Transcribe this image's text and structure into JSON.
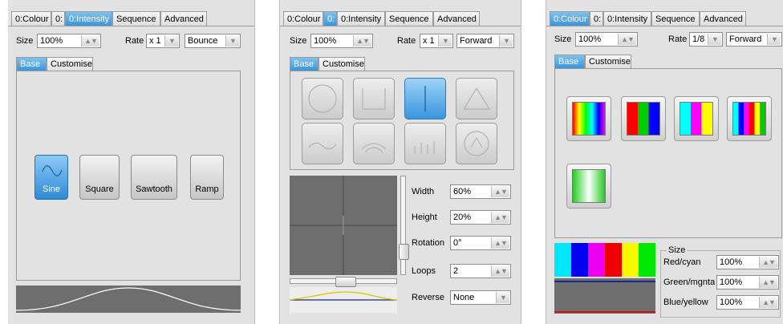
{
  "panel1": {
    "tabs": [
      "0:Colour",
      "0:",
      "0:Intensity",
      "Sequence",
      "Advanced"
    ],
    "active_tab": "0:Intensity",
    "size_label": "Size",
    "size_value": "100%",
    "rate_label": "Rate",
    "rate_value": "x 1",
    "mode_value": "Bounce",
    "subtabs": [
      "Base",
      "Customise"
    ],
    "waveforms": [
      "Sine",
      "Square",
      "Sawtooth",
      "Ramp"
    ],
    "selected_waveform": "Sine"
  },
  "panel2": {
    "tabs": [
      "0:Colour",
      "0:",
      "0:Intensity",
      "Sequence",
      "Advanced"
    ],
    "active_tab": "0:",
    "size_label": "Size",
    "size_value": "100%",
    "rate_label": "Rate",
    "rate_value": "x 1",
    "mode_value": "Forward",
    "subtabs": [
      "Base",
      "Customise"
    ],
    "shapes": [
      "circle",
      "square",
      "line",
      "triangle",
      "wave",
      "spiral",
      "bars",
      "star"
    ],
    "selected_shape": "line",
    "params": [
      {
        "label": "Width",
        "value": "60%"
      },
      {
        "label": "Height",
        "value": "20%"
      },
      {
        "label": "Rotation",
        "value": "0°"
      },
      {
        "label": "Loops",
        "value": "2"
      }
    ],
    "reverse_label": "Reverse",
    "reverse_value": "None"
  },
  "panel3": {
    "tabs": [
      "0:Colour",
      "0:",
      "0:Intensity",
      "Sequence",
      "Advanced"
    ],
    "active_tab": "0:Colour",
    "size_label": "Size",
    "size_value": "100%",
    "rate_label": "Rate",
    "rate_value": "1/8",
    "mode_value": "Forward",
    "subtabs": [
      "Base",
      "Customise"
    ],
    "color_presets": [
      "rainbow",
      "rgb",
      "cmy",
      "rainbow-bars",
      "green-fade"
    ],
    "size_group_label": "Size",
    "size_params": [
      {
        "label": "Red/cyan",
        "value": "100%"
      },
      {
        "label": "Green/mgnta",
        "value": "100%"
      },
      {
        "label": "Blue/yellow",
        "value": "100%"
      }
    ],
    "preview_colors": [
      "#00e8f8",
      "#0000f0",
      "#f000f0",
      "#f00000",
      "#f8f800",
      "#00e800"
    ]
  },
  "colors": {
    "accent_blue": "#3c94db",
    "panel_bg": "#e2e2e2",
    "preview_bg": "#6e6e6e"
  }
}
